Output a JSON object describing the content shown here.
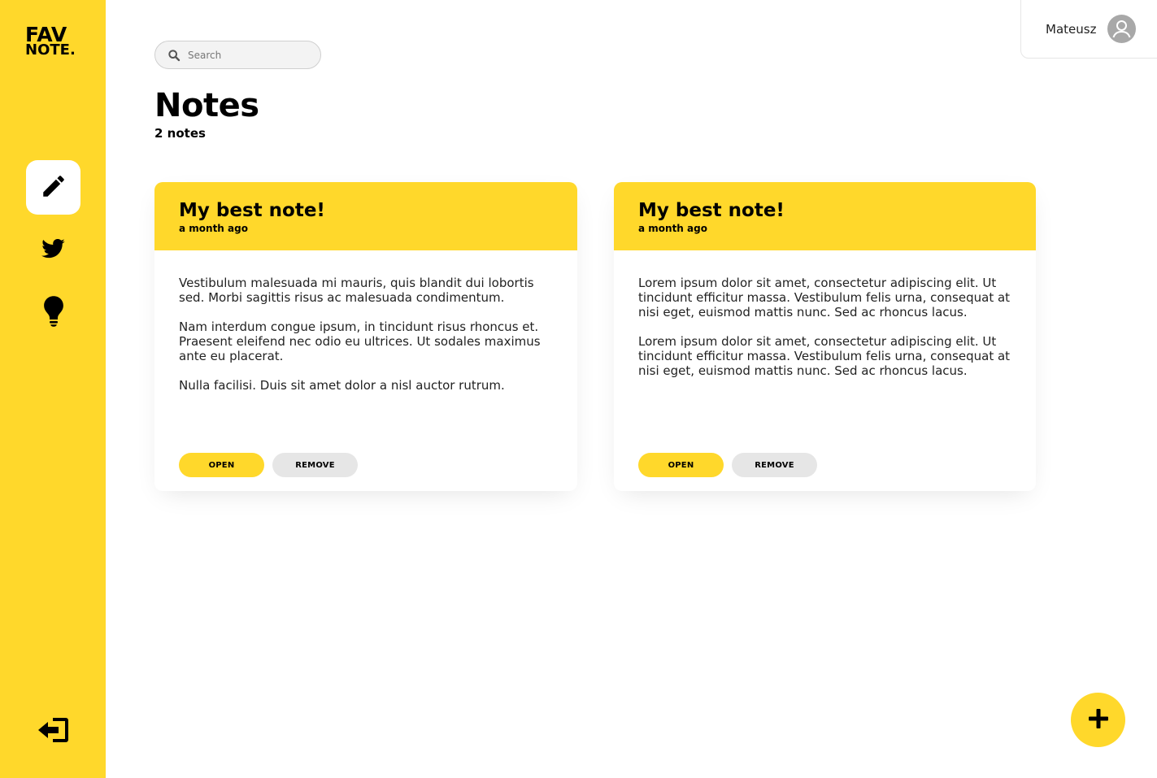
{
  "app": {
    "logo_line1": "FAV",
    "logo_line2": "NOTE."
  },
  "sidebar": {
    "items": [
      {
        "icon": "pen-icon",
        "active": true
      },
      {
        "icon": "twitter-icon",
        "active": false
      },
      {
        "icon": "bulb-icon",
        "active": false
      }
    ],
    "logout_icon": "logout-icon"
  },
  "search": {
    "placeholder": "Search",
    "value": ""
  },
  "user": {
    "name": "Mateusz"
  },
  "page": {
    "title": "Notes",
    "count": "2 notes"
  },
  "notes": [
    {
      "title": "My best note!",
      "date": "a month ago",
      "paragraphs": [
        "Vestibulum malesuada mi mauris, quis blandit dui lobortis sed. Morbi sagittis risus ac malesuada condimentum.",
        "Nam interdum congue ipsum, in tincidunt risus rhoncus et. Praesent eleifend nec odio eu ultrices. Ut sodales maximus ante eu placerat.",
        "Nulla facilisi. Duis sit amet dolor a nisl auctor rutrum."
      ],
      "open_label": "OPEN",
      "remove_label": "REMOVE"
    },
    {
      "title": "My best note!",
      "date": "a month ago",
      "paragraphs": [
        "Lorem ipsum dolor sit amet, consectetur adipiscing elit. Ut tincidunt efficitur massa. Vestibulum felis urna, consequat at nisi eget, euismod mattis nunc. Sed ac rhoncus lacus.",
        "Lorem ipsum dolor sit amet, consectetur adipiscing elit. Ut tincidunt efficitur massa. Vestibulum felis urna, consequat at nisi eget, euismod mattis nunc. Sed ac rhoncus lacus."
      ],
      "open_label": "OPEN",
      "remove_label": "REMOVE"
    }
  ],
  "fab": {
    "icon": "plus-icon"
  },
  "colors": {
    "accent": "#ffd82b",
    "muted_button": "#e6e6e6",
    "background": "#ffffff"
  }
}
